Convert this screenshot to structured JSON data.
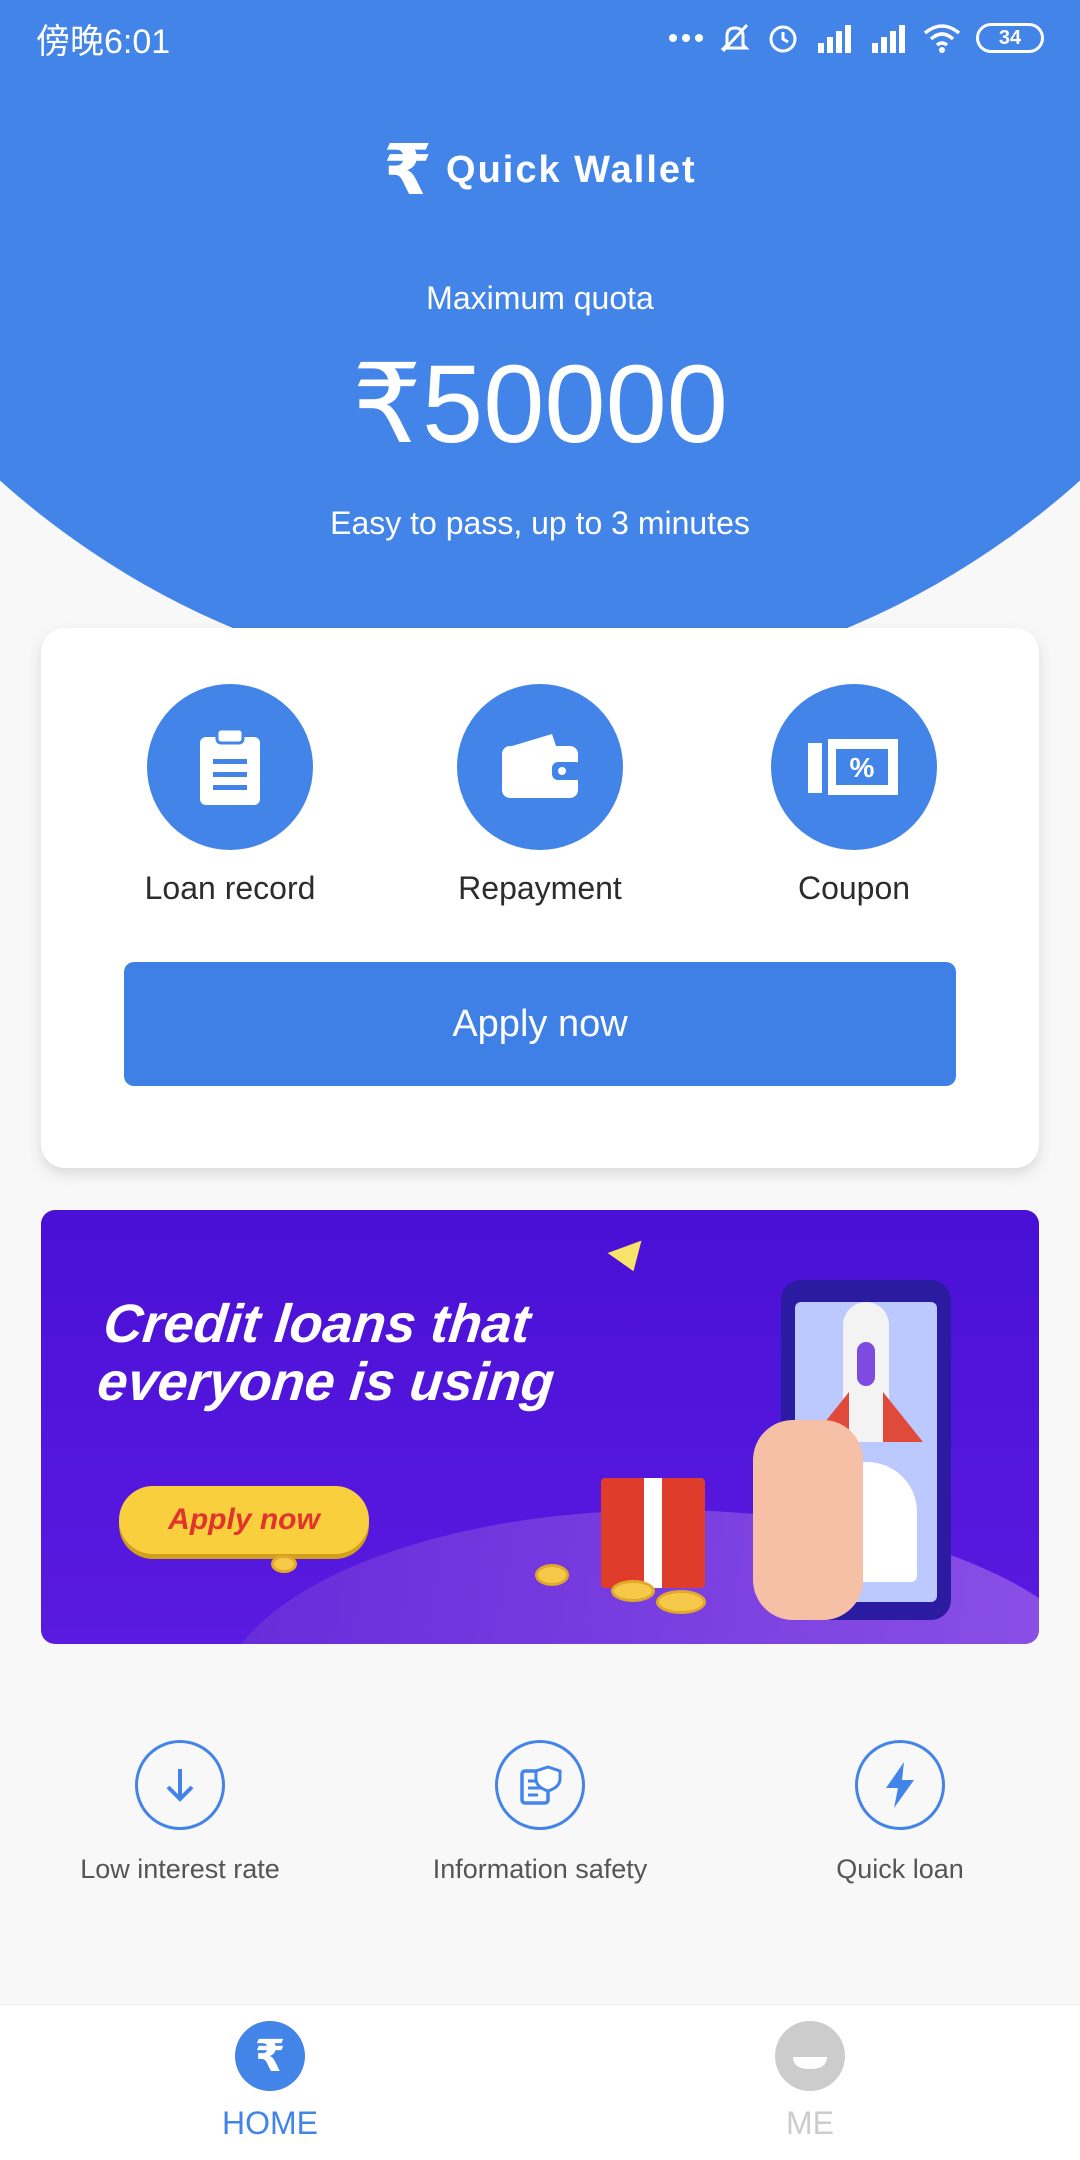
{
  "status_bar": {
    "time": "傍晚6:01",
    "battery": "34",
    "icons": [
      "more-dots-icon",
      "bell-muted-icon",
      "alarm-icon",
      "signal-r-icon",
      "signal-hd-icon",
      "wifi-icon",
      "battery-icon"
    ]
  },
  "brand": {
    "logo": "₹",
    "name": "Quick  Wallet"
  },
  "hero": {
    "quota_label": "Maximum quota",
    "quota_amount": "₹50000",
    "note": "Easy to pass, up to 3 minutes"
  },
  "actions": [
    {
      "label": "Loan record",
      "icon": "clipboard-icon"
    },
    {
      "label": "Repayment",
      "icon": "wallet-icon"
    },
    {
      "label": "Coupon",
      "icon": "coupon-icon"
    }
  ],
  "apply_button": "Apply now",
  "banner": {
    "title_line1": "Credit loans that",
    "title_line2": "everyone is using",
    "button": "Apply now"
  },
  "features": [
    {
      "label": "Low interest rate",
      "icon": "download-arrow-icon"
    },
    {
      "label": "Information safety",
      "icon": "secure-document-icon"
    },
    {
      "label": "Quick loan",
      "icon": "lightning-icon"
    }
  ],
  "tabs": [
    {
      "label": "HOME",
      "icon": "rupee-icon",
      "active": true
    },
    {
      "label": "ME",
      "icon": "profile-icon",
      "active": false
    }
  ],
  "colors": {
    "primary": "#4384e8",
    "active_tab": "#4384e8",
    "inactive_tab": "#cccccc",
    "banner_bg": "#4a10d6",
    "banner_button": "#f9cf3d"
  }
}
